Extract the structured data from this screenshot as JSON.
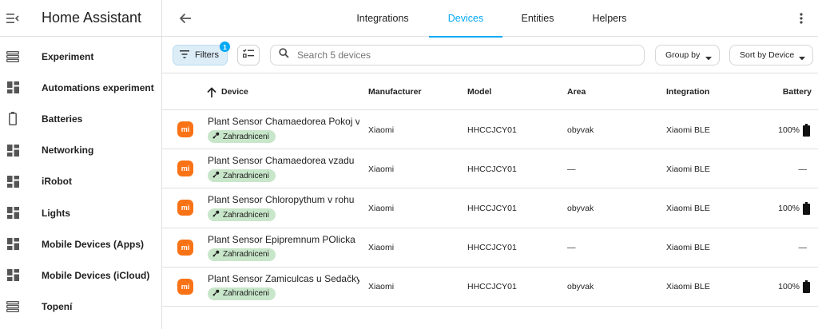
{
  "app": {
    "title": "Home Assistant"
  },
  "sidebar": {
    "items": [
      {
        "label": "Experiment",
        "icon": "view-list-icon"
      },
      {
        "label": "Automations experiment",
        "icon": "dashboard-icon"
      },
      {
        "label": "Batteries",
        "icon": "battery-icon"
      },
      {
        "label": "Networking",
        "icon": "dashboard-icon"
      },
      {
        "label": "iRobot",
        "icon": "dashboard-icon"
      },
      {
        "label": "Lights",
        "icon": "dashboard-icon"
      },
      {
        "label": "Mobile Devices (Apps)",
        "icon": "dashboard-icon"
      },
      {
        "label": "Mobile Devices (iCloud)",
        "icon": "dashboard-icon"
      },
      {
        "label": "Topení",
        "icon": "view-list-icon"
      }
    ]
  },
  "tabs": [
    {
      "label": "Integrations",
      "active": false
    },
    {
      "label": "Devices",
      "active": true
    },
    {
      "label": "Entities",
      "active": false
    },
    {
      "label": "Helpers",
      "active": false
    }
  ],
  "toolbar": {
    "filters_label": "Filters",
    "filters_count": "1",
    "search_placeholder": "Search 5 devices",
    "group_by_label": "Group by",
    "sort_label": "Sort by Device"
  },
  "table": {
    "columns": {
      "device": "Device",
      "manufacturer": "Manufacturer",
      "model": "Model",
      "area": "Area",
      "integration": "Integration",
      "battery": "Battery"
    },
    "rows": [
      {
        "name": "Plant Sensor Chamaedorea Pokoj vlevo",
        "label": "Zahradniceni",
        "manufacturer": "Xiaomi",
        "model": "HHCCJCY01",
        "area": "obyvak",
        "integration": "Xiaomi BLE",
        "battery": "100%",
        "has_battery_icon": true
      },
      {
        "name": "Plant Sensor Chamaedorea vzadu",
        "label": "Zahradniceni",
        "manufacturer": "Xiaomi",
        "model": "HHCCJCY01",
        "area": "—",
        "integration": "Xiaomi BLE",
        "battery": "—",
        "has_battery_icon": false
      },
      {
        "name": "Plant Sensor Chloropythum v rohu",
        "label": "Zahradniceni",
        "manufacturer": "Xiaomi",
        "model": "HHCCJCY01",
        "area": "obyvak",
        "integration": "Xiaomi BLE",
        "battery": "100%",
        "has_battery_icon": true
      },
      {
        "name": "Plant Sensor Epipremnum POlicka",
        "label": "Zahradniceni",
        "manufacturer": "Xiaomi",
        "model": "HHCCJCY01",
        "area": "—",
        "integration": "Xiaomi BLE",
        "battery": "—",
        "has_battery_icon": false
      },
      {
        "name": "Plant Sensor Zamiculcas u Sedačky",
        "label": "Zahradniceni",
        "manufacturer": "Xiaomi",
        "model": "HHCCJCY01",
        "area": "obyvak",
        "integration": "Xiaomi BLE",
        "battery": "100%",
        "has_battery_icon": true
      }
    ],
    "brand_icon_text": "mi"
  },
  "colors": {
    "accent": "#03a9f4",
    "brand_xiaomi": "#f97316",
    "label_chip": "#c8e6c9",
    "filters_bg": "#dcedf8"
  }
}
